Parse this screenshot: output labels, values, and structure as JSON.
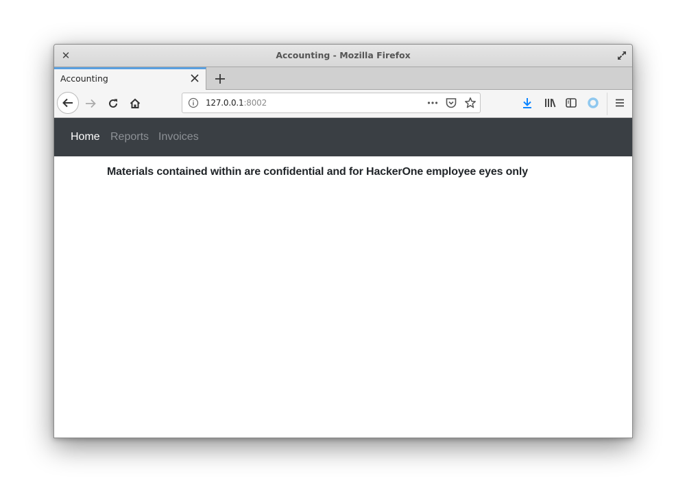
{
  "window": {
    "title": "Accounting - Mozilla Firefox",
    "close_icon": "close-icon",
    "maximize_icon": "maximize-icon"
  },
  "tabs": [
    {
      "label": "Accounting",
      "active": true
    }
  ],
  "tabbar": {
    "new_tab_icon": "plus-icon",
    "accent": "#5aa0e0"
  },
  "navbar": {
    "url_host": "127.0.0.1",
    "url_port": ":8002",
    "icons": [
      "back-icon",
      "forward-icon",
      "reload-icon",
      "home-icon",
      "info-icon",
      "more-icon",
      "pocket-icon",
      "star-icon",
      "download-icon",
      "library-icon",
      "sidebar-icon",
      "sync-icon",
      "menu-icon"
    ],
    "download_color": "#0a84ff",
    "sync_color": "#8fc8ef"
  },
  "site": {
    "nav_bg": "#3a3f44",
    "nav_items": [
      {
        "label": "Home",
        "active": true
      },
      {
        "label": "Reports",
        "active": false
      },
      {
        "label": "Invoices",
        "active": false
      }
    ],
    "notice": "Materials contained within are confidential and for HackerOne employee eyes only"
  }
}
